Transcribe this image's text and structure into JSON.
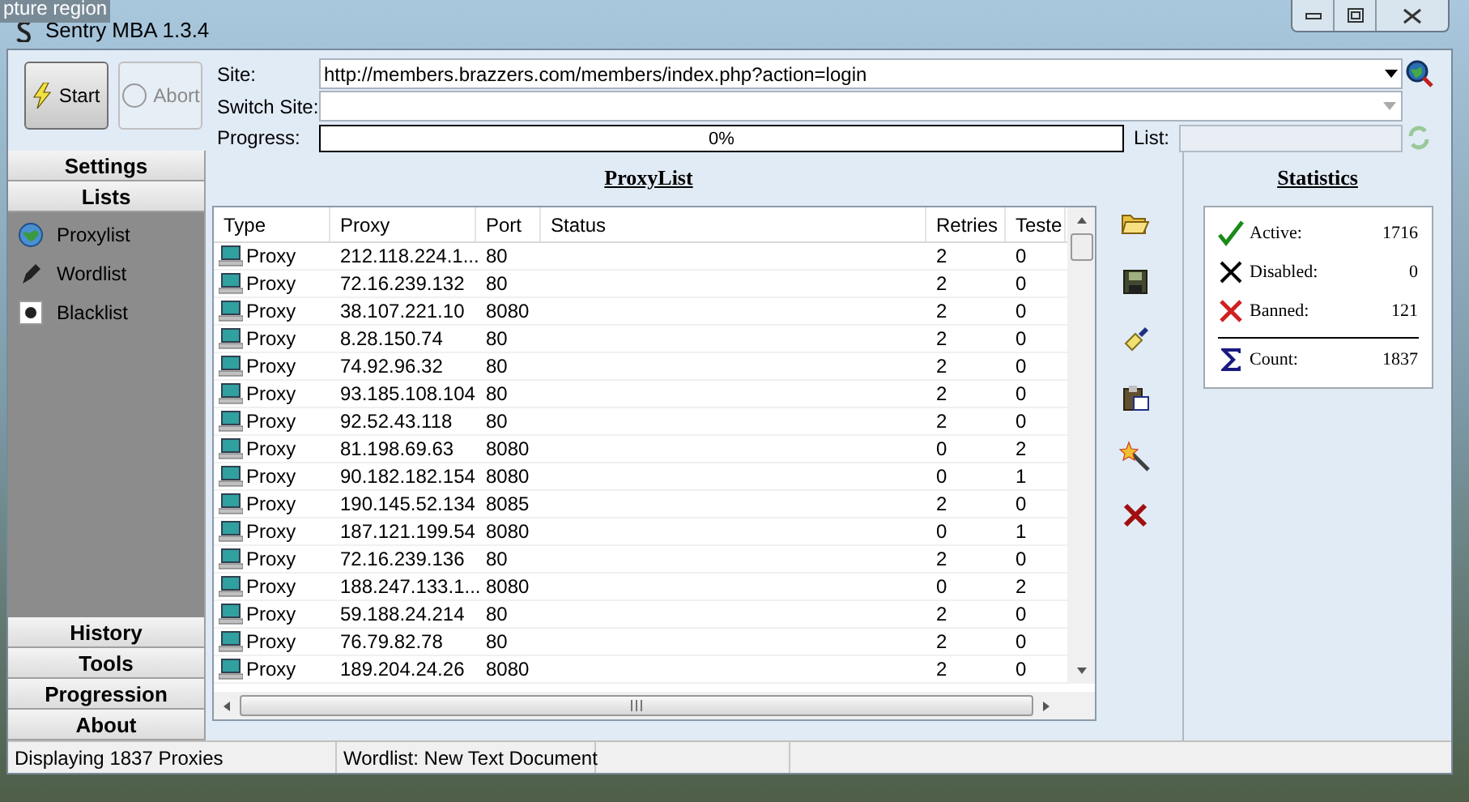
{
  "capture_label": "pture region",
  "window": {
    "title": "Sentry MBA 1.3.4"
  },
  "toolbar": {
    "start": {
      "label": "Start",
      "disabled": false
    },
    "abort": {
      "label": "Abort",
      "disabled": true
    },
    "site_label": "Site:",
    "site_value": "http://members.brazzers.com/members/index.php?action=login",
    "switch_label": "Switch Site:",
    "progress_label": "Progress:",
    "progress": {
      "level": 0,
      "reading": "0%"
    },
    "list_label": "List:"
  },
  "sidebar": {
    "top": [
      {
        "label": "Settings"
      },
      {
        "label": "Lists"
      }
    ],
    "items": [
      {
        "label": "Proxylist",
        "kind": "globe"
      },
      {
        "label": "Wordlist",
        "kind": "pen"
      },
      {
        "label": "Blacklist",
        "kind": "dot"
      }
    ],
    "bottom": [
      {
        "label": "History"
      },
      {
        "label": "Tools"
      },
      {
        "label": "Progression"
      },
      {
        "label": "About"
      }
    ]
  },
  "proxy_list": {
    "title": "ProxyList",
    "columns": [
      "Type",
      "Proxy",
      "Port",
      "Status",
      "Retries",
      "Teste"
    ],
    "rows": [
      [
        "Proxy",
        "212.118.224.1...",
        "80",
        "",
        "2",
        "0"
      ],
      [
        "Proxy",
        "72.16.239.132",
        "80",
        "",
        "2",
        "0"
      ],
      [
        "Proxy",
        "38.107.221.10",
        "8080",
        "",
        "2",
        "0"
      ],
      [
        "Proxy",
        "8.28.150.74",
        "80",
        "",
        "2",
        "0"
      ],
      [
        "Proxy",
        "74.92.96.32",
        "80",
        "",
        "2",
        "0"
      ],
      [
        "Proxy",
        "93.185.108.104",
        "80",
        "",
        "2",
        "0"
      ],
      [
        "Proxy",
        "92.52.43.118",
        "80",
        "",
        "2",
        "0"
      ],
      [
        "Proxy",
        "81.198.69.63",
        "8080",
        "",
        "0",
        "2"
      ],
      [
        "Proxy",
        "90.182.182.154",
        "8080",
        "",
        "0",
        "1"
      ],
      [
        "Proxy",
        "190.145.52.134",
        "8085",
        "",
        "2",
        "0"
      ],
      [
        "Proxy",
        "187.121.199.54",
        "8080",
        "",
        "0",
        "1"
      ],
      [
        "Proxy",
        "72.16.239.136",
        "80",
        "",
        "2",
        "0"
      ],
      [
        "Proxy",
        "188.247.133.1...",
        "8080",
        "",
        "0",
        "2"
      ],
      [
        "Proxy",
        "59.188.24.214",
        "80",
        "",
        "2",
        "0"
      ],
      [
        "Proxy",
        "76.79.82.78",
        "80",
        "",
        "2",
        "0"
      ],
      [
        "Proxy",
        "189.204.24.26",
        "8080",
        "",
        "2",
        "0"
      ]
    ]
  },
  "tools": [
    {
      "kind": "open"
    },
    {
      "kind": "save"
    },
    {
      "kind": "clean"
    },
    {
      "kind": "paste"
    },
    {
      "kind": "magic"
    },
    {
      "kind": "delete"
    }
  ],
  "statistics": {
    "title": "Statistics",
    "rows": [
      {
        "kind": "active",
        "label": "Active:",
        "value": "1716"
      },
      {
        "kind": "disabled",
        "label": "Disabled:",
        "value": "0"
      },
      {
        "kind": "banned",
        "label": "Banned:",
        "value": "121"
      },
      {
        "kind": "count",
        "label": "Count:",
        "value": "1837"
      }
    ]
  },
  "status_bar": [
    "Displaying 1837 Proxies",
    "Wordlist: New Text Document"
  ]
}
